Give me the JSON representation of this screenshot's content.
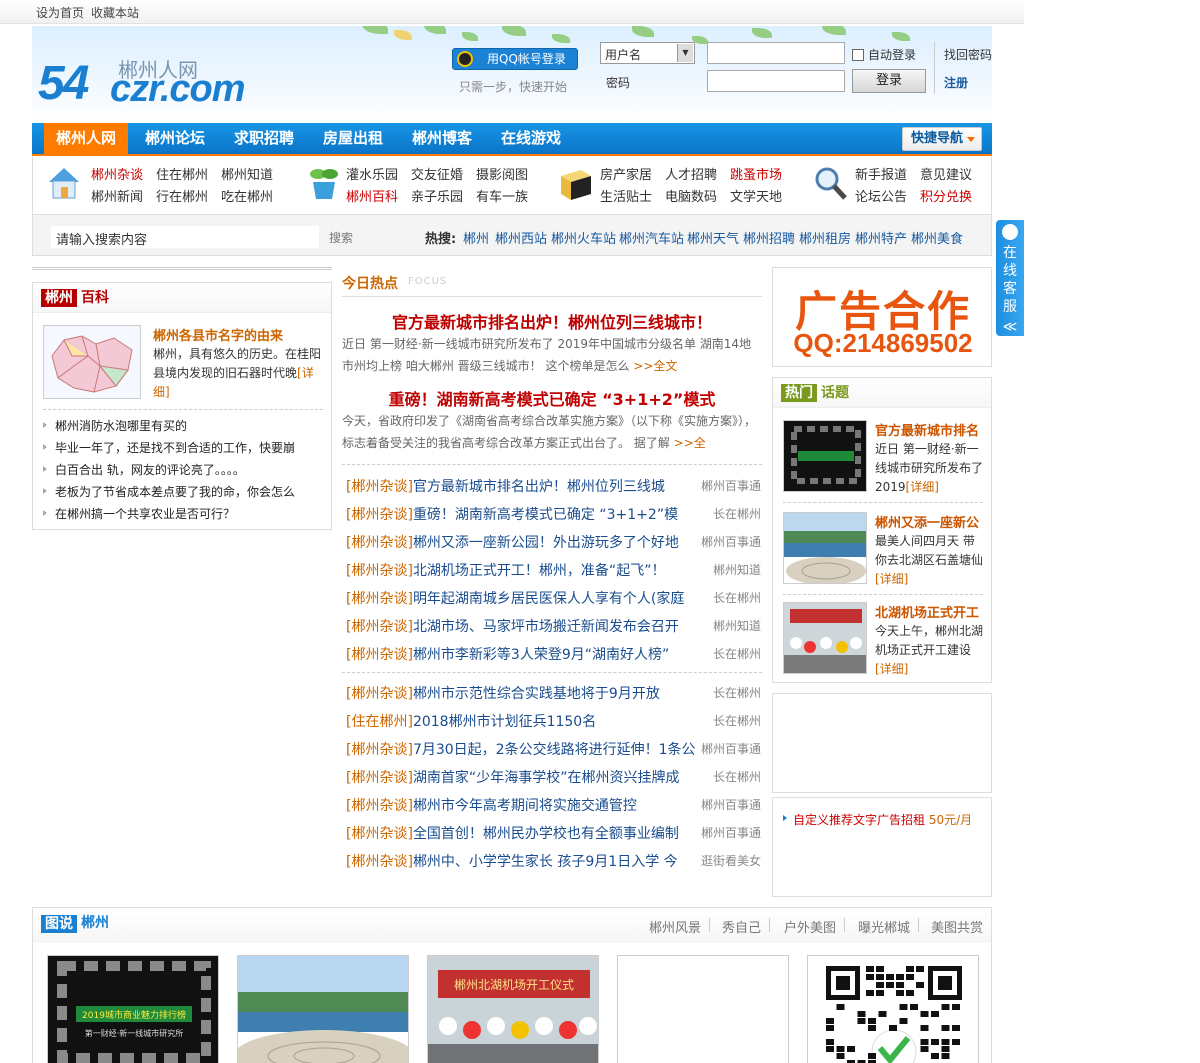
{
  "topbar": {
    "set_home": "设为首页",
    "bookmark": "收藏本站"
  },
  "header": {
    "logo_cn": "郴州人网",
    "logo_num": "54",
    "logo_domain": "czr.com",
    "qq_login": "用QQ帐号登录",
    "qq_tip": "只需一步，快速开始",
    "username_select": "用户名",
    "password_label": "密码",
    "auto_login": "自动登录",
    "find_password": "找回密码",
    "login_button": "登录",
    "register": "注册"
  },
  "nav": {
    "items": [
      "郴州人网",
      "郴州论坛",
      "求职招聘",
      "房屋出租",
      "郴州博客",
      "在线游戏"
    ],
    "quick_nav": "快捷导航"
  },
  "subnav": {
    "group1": {
      "icon": "house-icon",
      "links": [
        "郴州杂谈",
        "住在郴州",
        "郴州知道",
        "郴州新闻",
        "行在郴州",
        "吃在郴州"
      ]
    },
    "group2": {
      "icon": "plant-icon",
      "links": [
        "灌水乐园",
        "交友征婚",
        "摄影阅图",
        "郴州百科",
        "亲子乐园",
        "有车一族"
      ]
    },
    "group3": {
      "icon": "box-icon",
      "links": [
        "房产家居",
        "人才招聘",
        "跳蚤市场",
        "生活贴士",
        "电脑数码",
        "文学天地"
      ]
    },
    "group4": {
      "icon": "magnifier-icon",
      "links": [
        "新手报道",
        "意见建议",
        "论坛公告",
        "积分兑换"
      ]
    },
    "colors": {
      "highlight": "#cc0000"
    }
  },
  "search": {
    "placeholder": "请输入搜索内容",
    "button": "搜索",
    "hot_label": "热搜:",
    "hot_keywords": [
      "郴州",
      "郴州西站",
      "郴州火车站",
      "郴州汽车站",
      "郴州天气",
      "郴州招聘",
      "郴州租房",
      "郴州特产",
      "郴州美食"
    ]
  },
  "baike": {
    "tag": "郴州",
    "title": "百科",
    "feature_title": "郴州各县市名字的由来",
    "feature_text": "郴州，具有悠久的历史。在桂阳县境内发现的旧石器时代晚",
    "feature_more": "[详细]",
    "list": [
      "郴州消防水泡哪里有买的",
      "毕业一年了，还是找不到合适的工作，快要崩",
      "白百合出 轨，网友的评论亮了。。。。",
      "老板为了节省成本差点要了我的命，你会怎么",
      "在郴州搞一个共享农业是否可行？"
    ]
  },
  "today": {
    "title": "今日热点",
    "focus": "FOCUS",
    "headline1": "官方最新城市排名出炉！郴州位列三线城市！",
    "summary1": "近日 第一财经·新一线城市研究所发布了 2019年中国城市分级名单 湖南14地市州均上榜 咱大郴州 晋级三线城市！ 这个榜单是怎么",
    "more1": ">>全文",
    "headline2": "重磅！湖南新高考模式已确定 “3+1+2”模式",
    "summary2": "今天，省政府印发了《湖南省高考综合改革实施方案》（以下称《实施方案》），标志着备受关注的我省高考综合改革方案正式出台了。 据了解",
    "more2": ">>全",
    "news_a": [
      {
        "cat": "[郴州杂谈]",
        "title": "官方最新城市排名出炉！郴州位列三线城",
        "src": "郴州百事通"
      },
      {
        "cat": "[郴州杂谈]",
        "title": "重磅！湖南新高考模式已确定 “3+1+2”模",
        "src": "长在郴州"
      },
      {
        "cat": "[郴州杂谈]",
        "title": "郴州又添一座新公园！外出游玩多了个好地",
        "src": "郴州百事通"
      },
      {
        "cat": "[郴州杂谈]",
        "title": "北湖机场正式开工！郴州，准备“起飞”！",
        "src": "郴州知道"
      },
      {
        "cat": "[郴州杂谈]",
        "title": "明年起湖南城乡居民医保人人享有个人(家庭",
        "src": "长在郴州"
      },
      {
        "cat": "[郴州杂谈]",
        "title": "北湖市场、马家坪市场搬迁新闻发布会召开",
        "src": "郴州知道"
      },
      {
        "cat": "[郴州杂谈]",
        "title": "郴州市李新彩等3人荣登9月“湖南好人榜”",
        "src": "长在郴州"
      }
    ],
    "news_b": [
      {
        "cat": "[郴州杂谈]",
        "title": "郴州市示范性综合实践基地将于9月开放",
        "src": "长在郴州"
      },
      {
        "cat": "[住在郴州]",
        "title": "2018郴州市计划征兵1150名",
        "src": "长在郴州"
      },
      {
        "cat": "[郴州杂谈]",
        "title": "7月30日起，2条公交线路将进行延伸！1条公",
        "src": "郴州百事通"
      },
      {
        "cat": "[郴州杂谈]",
        "title": "湖南首家“少年海事学校”在郴州资兴挂牌成",
        "src": "长在郴州"
      },
      {
        "cat": "[郴州杂谈]",
        "title": "郴州市今年高考期间将实施交通管控",
        "src": "郴州百事通"
      },
      {
        "cat": "[郴州杂谈]",
        "title": "全国首创！郴州民办学校也有全额事业编制",
        "src": "郴州百事通"
      },
      {
        "cat": "[郴州杂谈]",
        "title": "郴州中、小学学生家长 孩子9月1日入学 今",
        "src": "逛街看美女"
      }
    ]
  },
  "ad": {
    "line1": "广告合作",
    "line2": "QQ:214869502"
  },
  "hot": {
    "tag": "热门",
    "title": "话题",
    "items": [
      {
        "title": "官方最新城市排名",
        "text": "近日 第一财经·新一线城市研究所发布了 2019",
        "more": "[详细]"
      },
      {
        "title": "郴州又添一座新公",
        "text": "最美人间四月天 带你去北湖区石盖塘仙",
        "more": "[详细]"
      },
      {
        "title": "北湖机场正式开工",
        "text": "今天上午，郴州北湖机场正式开工建设",
        "more": "[详细]"
      }
    ]
  },
  "custom_ad": {
    "text": "自定义推荐文字广告招租",
    "price": "50元/月"
  },
  "side": {
    "label": "在线客服",
    "arrow": "≪"
  },
  "photos": {
    "tag": "图说",
    "title": "郴州",
    "tabs": [
      "郴州风景",
      "秀自己",
      "户外美图",
      "曝光郴城",
      "美图共赏"
    ],
    "rank_img_text": "2019城市商业魅力排行榜",
    "rank_img_sub": "第一财经·新一线城市研究所",
    "airport_text": "郴州北湖机场开工仪式"
  }
}
